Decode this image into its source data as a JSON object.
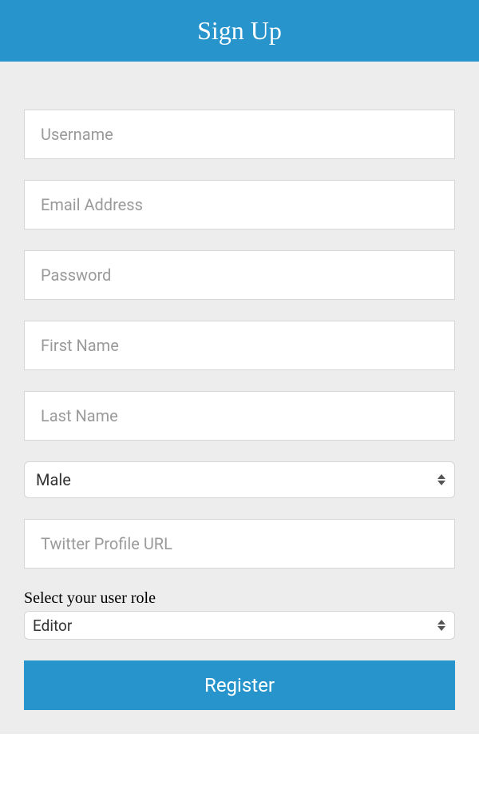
{
  "header": {
    "title": "Sign Up"
  },
  "form": {
    "username_placeholder": "Username",
    "email_placeholder": "Email Address",
    "password_placeholder": "Password",
    "firstname_placeholder": "First Name",
    "lastname_placeholder": "Last Name",
    "gender_selected": "Male",
    "twitter_placeholder": "Twitter Profile URL",
    "role_label": "Select your user role",
    "role_selected": "Editor",
    "submit_label": "Register"
  },
  "colors": {
    "primary": "#2894cc",
    "panel_bg": "#ededed",
    "input_border": "#d6d6d6",
    "placeholder": "#9a9a9a"
  }
}
